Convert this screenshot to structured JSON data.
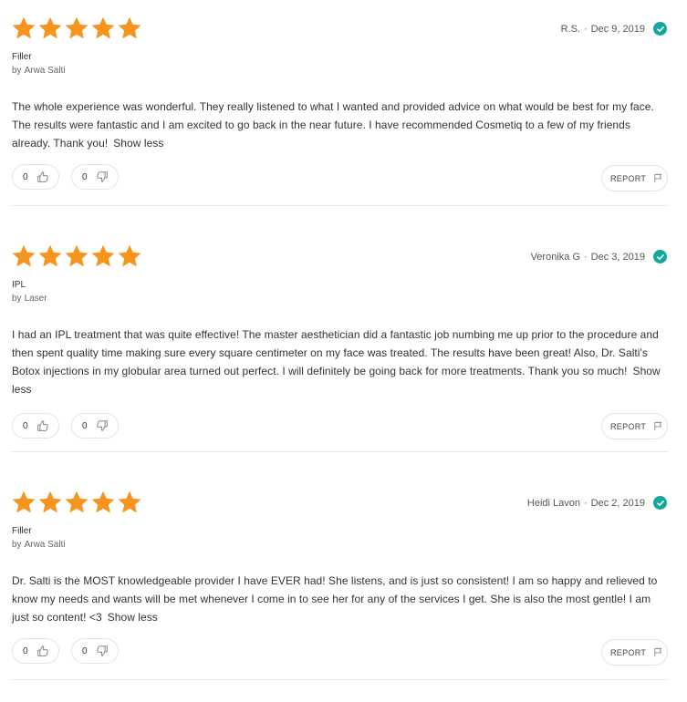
{
  "colors": {
    "star": "#f7941d",
    "verified": "#13a89e"
  },
  "reviews": [
    {
      "rating": 5,
      "author": "R.S.",
      "date": "Dec 9, 2019",
      "treatment": "Filler",
      "provider_prefix": "by",
      "provider": "Arwa Salti",
      "body": "The whole experience was wonderful. They really listened to what I wanted and provided advice on what would be best for my face. The results were fantastic and I am excited to go back in the near future. I have recommended Cosmetiq to a few of my friends already. Thank you!",
      "show_less": "Show less",
      "helpful_count": "0",
      "unhelpful_count": "0",
      "report_label": "REPORT"
    },
    {
      "rating": 5,
      "author": "Veronika G",
      "date": "Dec 3, 2019",
      "treatment": "IPL",
      "provider_prefix": "by",
      "provider": "Laser",
      "body": "I had an IPL treatment that was quite effective! The master aesthetician did a fantastic job numbing me up prior to the procedure and then spent quality time making sure every square centimeter on my face was treated. The results have been great! Also, Dr. Salti's Botox injections in my globular area turned out perfect. I will definitely be going back for more treatments. Thank you so much!",
      "show_less": "Show less",
      "helpful_count": "0",
      "unhelpful_count": "0",
      "report_label": "REPORT"
    },
    {
      "rating": 5,
      "author": "Heidi Lavon",
      "date": "Dec 2, 2019",
      "treatment": "Filler",
      "provider_prefix": "by",
      "provider": "Arwa Salti",
      "body": "Dr. Salti is the MOST knowledgeable provider I have EVER had! She listens, and is just so consistent! I am so happy and relieved to know my needs and wants will be met whenever I come in to see her for any of the services I get. She is also the most gentle! I am just so content! <3",
      "show_less": "Show less",
      "helpful_count": "0",
      "unhelpful_count": "0",
      "report_label": "REPORT"
    }
  ]
}
